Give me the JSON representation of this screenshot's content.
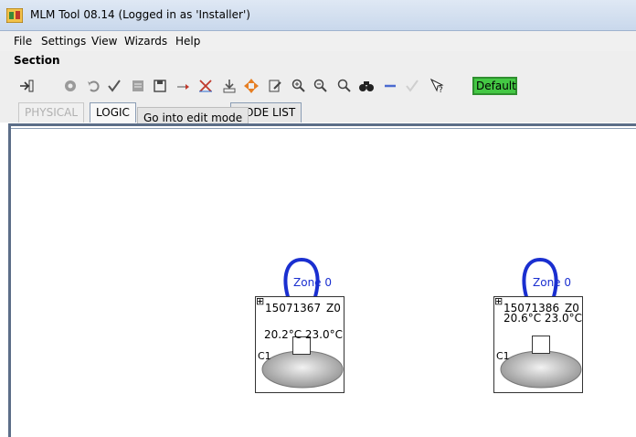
{
  "window": {
    "title": "MLM Tool 08.14  (Logged in as 'Installer')"
  },
  "menu": {
    "items": [
      "File",
      "Settings",
      "View",
      "Wizards",
      "Help"
    ]
  },
  "section": {
    "label": "Section"
  },
  "toolbar": {
    "icons": [
      "exit-icon",
      "settings-icon",
      "undo-icon",
      "check-icon",
      "notes-icon",
      "save-icon",
      "move-icon",
      "delete-icon",
      "import-icon",
      "arrows-icon",
      "edit-mode-icon",
      "zoom-in-icon",
      "zoom-out-icon",
      "zoom-reset-icon",
      "find-icon",
      "minus-icon",
      "check-disabled-icon",
      "help-pointer-icon"
    ],
    "default_label": "Default"
  },
  "tabs": [
    {
      "label": "PHYSICAL",
      "state": "disabled"
    },
    {
      "label": "LOGIC",
      "state": "active"
    },
    {
      "label": "NODE LIST",
      "state": "normal"
    }
  ],
  "tooltip": {
    "text": "Go into edit mode"
  },
  "nodes": [
    {
      "id": "15071367",
      "zone": "Z0",
      "temps": "20.2°C  23.0°C",
      "channel": "C1",
      "zone_label": "Zone 0"
    },
    {
      "id": "15071386",
      "zone": "Z0",
      "temps": "20.6°C 23.0°C",
      "channel": "C1",
      "zone_label": "Zone 0"
    }
  ],
  "colors": {
    "zone_loop": "#1a2fd0",
    "default_badge": "#44c844",
    "canvas_border": "#5c6e88"
  }
}
